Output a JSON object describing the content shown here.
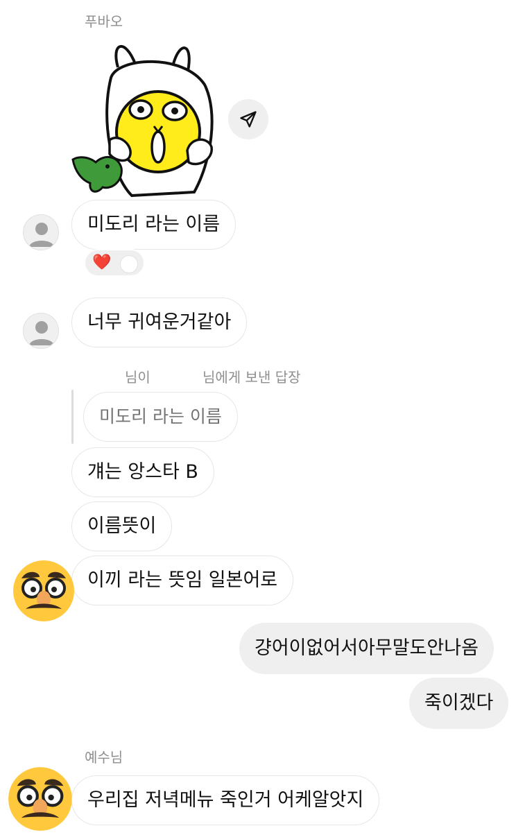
{
  "thread": {
    "sender_top": "푸바오",
    "messages": [
      {
        "text": "미도리 라는 이름"
      },
      {
        "text": "너무 귀여운거같아"
      }
    ],
    "reaction_emoji": "❤️",
    "reply": {
      "meta_a": "님이",
      "meta_b": "님에게 보낸 답장",
      "quoted": "미도리 라는 이름"
    },
    "group": [
      {
        "text": "걔는 앙스타 B"
      },
      {
        "text": "이름뜻이"
      },
      {
        "text": "이끼 라는 뜻임 일본어로"
      }
    ],
    "outgoing": [
      {
        "text": "걍어이없어서아무말도안나옴"
      },
      {
        "text": "죽이겠다"
      }
    ],
    "sender_bottom": "예수님",
    "last_message": {
      "text": "우리집 저녁메뉴 죽인거 어케알앗지"
    }
  },
  "colors": {
    "outgoing_bubble": "#efefef",
    "incoming_border": "#e6e6e6",
    "meta_text": "#8e8e8e",
    "heart": "#ed4956"
  },
  "icons": {
    "share": "paper-plane-icon",
    "avatar_default": "default-user-icon",
    "avatar_emoji": "disguise-face-emoji"
  }
}
